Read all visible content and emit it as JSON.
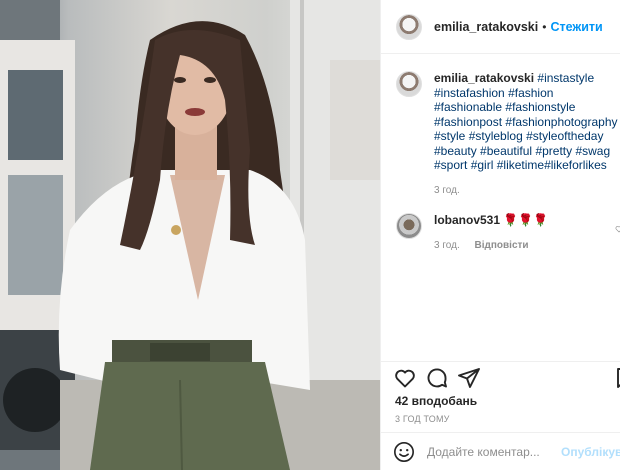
{
  "post": {
    "username": "emilia_ratakovski",
    "separator": "•",
    "follow_label": "Стежити"
  },
  "caption": {
    "username": "emilia_ratakovski",
    "hashtags": [
      "#instastyle",
      "#instafashion",
      "#fashion",
      "#fashionable",
      "#fashionstyle",
      "#fashionpost",
      "#fashionphotography",
      "#style",
      "#styleblog",
      "#styleoftheday",
      "#beauty",
      "#beautiful",
      "#pretty",
      "#swag",
      "#sport",
      "#girl",
      "#liketime",
      "#likeforlikes"
    ],
    "time": "3 год."
  },
  "comment": {
    "username": "lobanov531",
    "text": "🌹🌹🌹",
    "time": "3 год.",
    "reply_label": "Відповісти"
  },
  "actions": {
    "likes": "42 вподобань",
    "posted_ago": "3 ГОД ТОМУ"
  },
  "add_comment": {
    "placeholder": "Додайте коментар...",
    "post_label": "Опублікувати"
  },
  "icons": [
    "heart-icon",
    "comment-icon",
    "share-icon",
    "bookmark-icon",
    "smile-icon"
  ],
  "colors": {
    "accent": "#0095f6",
    "hashtag": "#00376b",
    "muted": "#8e8e8e",
    "post_disabled": "#b2dffc"
  }
}
